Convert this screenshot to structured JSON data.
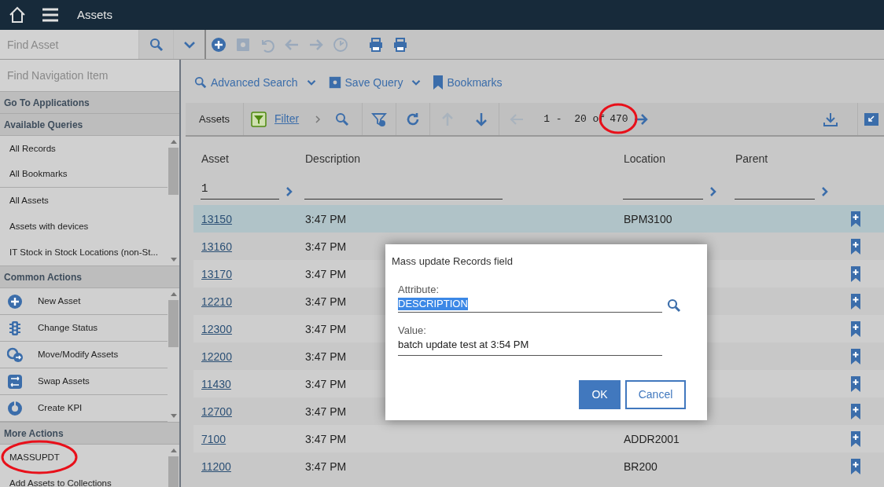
{
  "header": {
    "title": "Assets"
  },
  "toolbar": {
    "search_placeholder": "Find Asset",
    "actions": [
      {
        "kind": "add",
        "disabled": false
      },
      {
        "kind": "save",
        "disabled": true
      },
      {
        "kind": "undo",
        "disabled": true
      },
      {
        "kind": "back",
        "disabled": true
      },
      {
        "kind": "forward",
        "disabled": true
      },
      {
        "kind": "clock",
        "disabled": true
      },
      {
        "kind": "print",
        "disabled": false
      },
      {
        "kind": "print",
        "disabled": false
      }
    ]
  },
  "sidebar": {
    "nav_placeholder": "Find Navigation Item",
    "sections": [
      {
        "title": "Go To Applications"
      },
      {
        "title": "Available Queries",
        "kind": "queries",
        "items": [
          {
            "label": "All Records",
            "circled": false
          },
          {
            "label": "All Bookmarks",
            "circled": false
          },
          {
            "label": "All Assets",
            "circled": false
          },
          {
            "label": "Assets with devices",
            "circled": false
          },
          {
            "label": "IT Stock in Stock Locations (non-St...",
            "circled": false
          }
        ]
      },
      {
        "title": "Common Actions",
        "kind": "actions",
        "items": [
          {
            "label": "New Asset",
            "circled": false
          },
          {
            "label": "Change Status",
            "circled": false
          },
          {
            "label": "Move/Modify Assets",
            "circled": false
          },
          {
            "label": "Swap Assets",
            "circled": false
          },
          {
            "label": "Create KPI",
            "circled": false
          }
        ]
      },
      {
        "title": "More Actions",
        "kind": "more",
        "items": [
          {
            "label": "MASSUPDT",
            "circled": true
          },
          {
            "label": "Add Assets to Collections",
            "circled": false
          }
        ]
      }
    ]
  },
  "query_bar": [
    {
      "label": "Advanced Search",
      "dropdown": true
    },
    {
      "label": "Save Query",
      "dropdown": true
    },
    {
      "label": "Bookmarks",
      "dropdown": false
    }
  ],
  "table_toolbar": {
    "title": "Assets",
    "filter": "Filter",
    "range": "1 -  20 of",
    "total": "470",
    "total_circled": true
  },
  "table": {
    "columns": [
      {
        "label": "Asset",
        "filter": "1"
      },
      {
        "label": "Description"
      },
      {
        "label": "Location"
      },
      {
        "label": "Parent"
      }
    ],
    "rows": [
      {
        "asset": "13150",
        "description": "3:47 PM",
        "location": "BPM3100",
        "selected": true
      },
      {
        "asset": "13160",
        "description": "3:47 PM",
        "selected": false
      },
      {
        "asset": "13170",
        "description": "3:47 PM",
        "selected": false
      },
      {
        "asset": "12210",
        "description": "3:47 PM",
        "selected": false
      },
      {
        "asset": "12300",
        "description": "3:47 PM",
        "selected": false
      },
      {
        "asset": "12200",
        "description": "3:47 PM",
        "selected": false
      },
      {
        "asset": "11430",
        "description": "3:47 PM",
        "selected": false
      },
      {
        "asset": "12700",
        "description": "3:47 PM",
        "selected": false
      },
      {
        "asset": "7100",
        "description": "3:47 PM",
        "location": "ADDR2001",
        "selected": false
      },
      {
        "asset": "11200",
        "description": "3:47 PM",
        "location": "BR200",
        "selected": false
      }
    ]
  },
  "dialog": {
    "title": "Mass update Records field",
    "attribute_label": "Attribute:",
    "attribute_value": "DESCRIPTION",
    "attribute_selected": true,
    "value_label": "Value:",
    "value": "batch update test at 3:54 PM",
    "buttons": [
      {
        "label": "OK",
        "primary": true
      },
      {
        "label": "Cancel",
        "primary": false
      }
    ]
  }
}
